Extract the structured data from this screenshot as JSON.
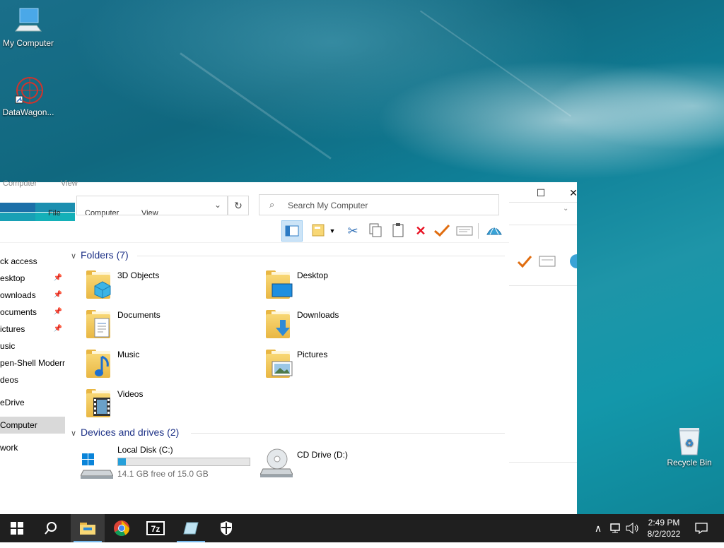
{
  "desktop": {
    "icons": [
      {
        "label": "My Computer"
      },
      {
        "label": "DataWagon..."
      },
      {
        "label": "Recycle Bin"
      }
    ]
  },
  "back_window": {
    "tabs": [
      "Computer",
      "View"
    ],
    "close": "✕",
    "maximize": "☐"
  },
  "window": {
    "tabs": {
      "file": "File",
      "computer": "Computer",
      "view": "View"
    },
    "search_placeholder": "Search My Computer",
    "nav": [
      {
        "label": "ck access"
      },
      {
        "label": "esktop",
        "pinned": true
      },
      {
        "label": "ownloads",
        "pinned": true
      },
      {
        "label": "ocuments",
        "pinned": true
      },
      {
        "label": "ictures",
        "pinned": true
      },
      {
        "label": "usic"
      },
      {
        "label": "pen-Shell Modern"
      },
      {
        "label": "deos"
      },
      {
        "label": "eDrive"
      },
      {
        "label": "Computer",
        "selected": true
      },
      {
        "label": "work"
      }
    ],
    "folders_heading": "Folders (7)",
    "folders": [
      {
        "name": "3D Objects",
        "icon": "3d-objects-icon"
      },
      {
        "name": "Desktop",
        "icon": "desktop-folder-icon"
      },
      {
        "name": "Documents",
        "icon": "documents-icon"
      },
      {
        "name": "Downloads",
        "icon": "downloads-icon"
      },
      {
        "name": "Music",
        "icon": "music-icon"
      },
      {
        "name": "Pictures",
        "icon": "pictures-icon"
      },
      {
        "name": "Videos",
        "icon": "videos-icon"
      }
    ],
    "drives_heading": "Devices and drives (2)",
    "drives": [
      {
        "name": "Local Disk (C:)",
        "free_text": "14.1 GB free of 15.0 GB",
        "used_fraction": 0.06
      },
      {
        "name": "CD Drive (D:)"
      }
    ]
  },
  "taskbar": {
    "time": "2:49 PM",
    "date": "8/2/2022"
  },
  "colors": {
    "accent": "#26a0da",
    "heading": "#1e3287",
    "taskbar": "#1f1f1f"
  }
}
